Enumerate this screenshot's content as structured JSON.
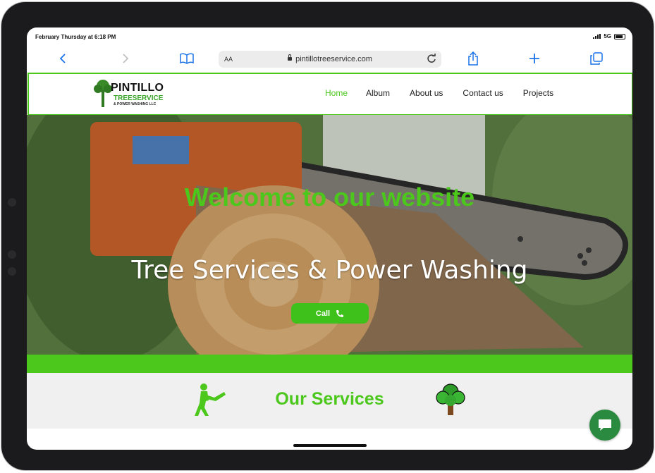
{
  "status_bar": {
    "datetime": "February Thursday at 6:18 PM",
    "network": "5G"
  },
  "browser": {
    "text_size_label": "AA",
    "url": "pintillotreeservice.com",
    "icons": [
      "back-icon",
      "forward-icon",
      "bookmarks-icon",
      "reload-icon",
      "share-icon",
      "new-tab-icon",
      "tabs-icon"
    ]
  },
  "site": {
    "logo": {
      "name": "PINTILLO",
      "line2": "TREESERVICE",
      "line3": "& POWER WASHING LLC"
    },
    "nav": [
      {
        "label": "Home",
        "active": true
      },
      {
        "label": "Album",
        "active": false
      },
      {
        "label": "About us",
        "active": false
      },
      {
        "label": "Contact us",
        "active": false
      },
      {
        "label": "Projects",
        "active": false
      }
    ],
    "hero": {
      "heading": "Welcome to our website",
      "subheading": "Tree Services & Power Washing",
      "call_button": "Call"
    },
    "services": {
      "title": "Our Services"
    }
  },
  "colors": {
    "brand_green": "#4cc71c",
    "call_button": "#3fc11b",
    "chat_button": "#2a8a3f",
    "safari_blue": "#1a73e8"
  }
}
